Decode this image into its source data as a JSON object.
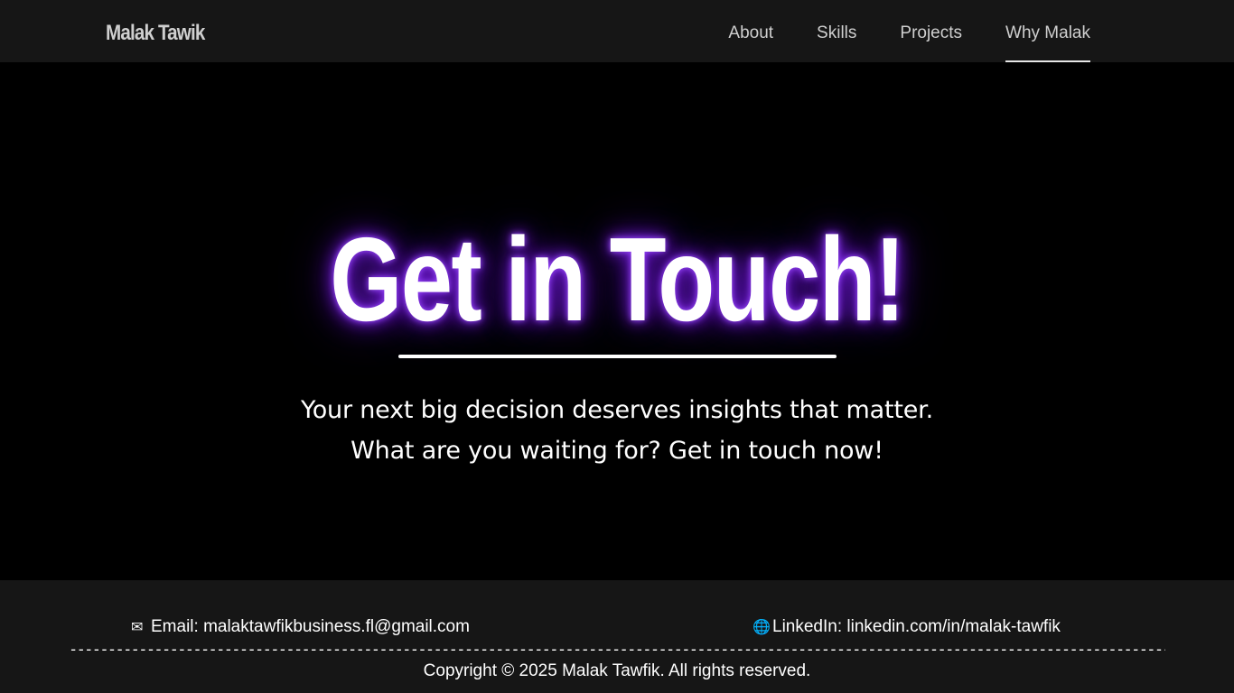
{
  "navbar": {
    "brand": "Malak Tawik",
    "links": [
      {
        "label": "About"
      },
      {
        "label": "Skills"
      },
      {
        "label": "Projects"
      },
      {
        "label": "Why Malak",
        "active": true
      }
    ]
  },
  "hero": {
    "title": "Get in Touch!",
    "line1": "Your next big decision deserves insights that matter.",
    "line2": "What are you waiting for? Get in touch now!",
    "glow_color": "#7a1fe0"
  },
  "footer": {
    "email_icon": "envelope-icon",
    "email_icon_glyph": "✉",
    "email": "Email: malaktawfikbusiness.fl@gmail.com",
    "linkedin_icon": "globe-icon",
    "linkedin_icon_glyph": "🌐",
    "linkedin": "LinkedIn: linkedin.com/in/malak-tawfik",
    "divider": "--------------------------------------------------------------------------------------------------------------------------------------------------------",
    "copyright": "Copyright © 2025 Malak Tawfik. All rights reserved."
  }
}
